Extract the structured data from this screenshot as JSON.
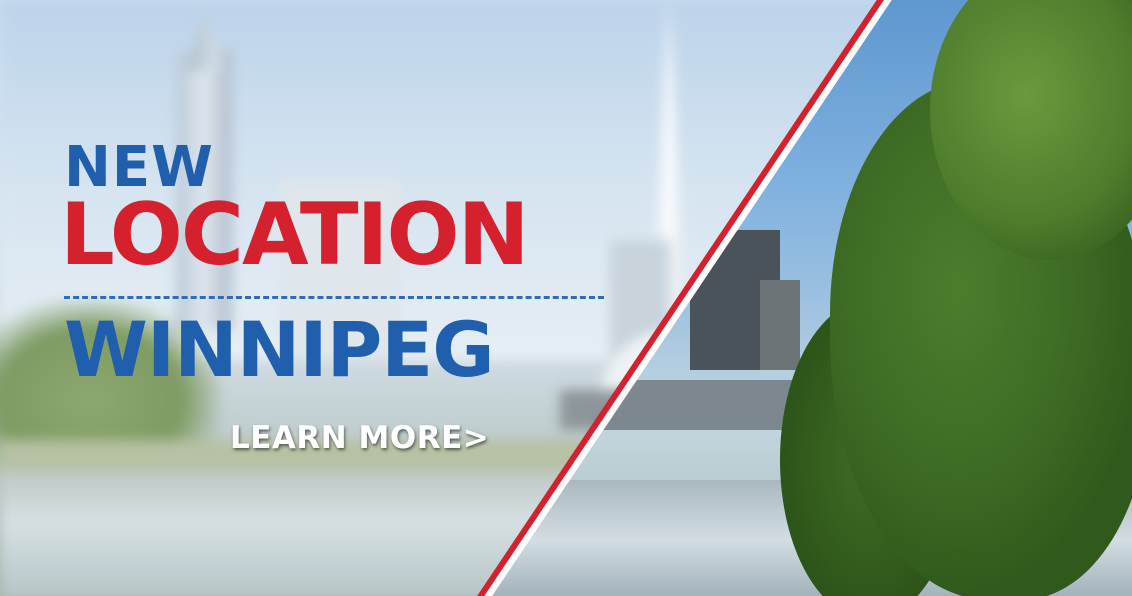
{
  "banner": {
    "headline_top": "NEW",
    "headline_main": "LOCATION",
    "city": "WINNIPEG",
    "cta_label": "LEARN MORE",
    "cta_arrow": ">"
  },
  "colors": {
    "blue": "#1f5fae",
    "red": "#d5202e",
    "white": "#ffffff"
  }
}
